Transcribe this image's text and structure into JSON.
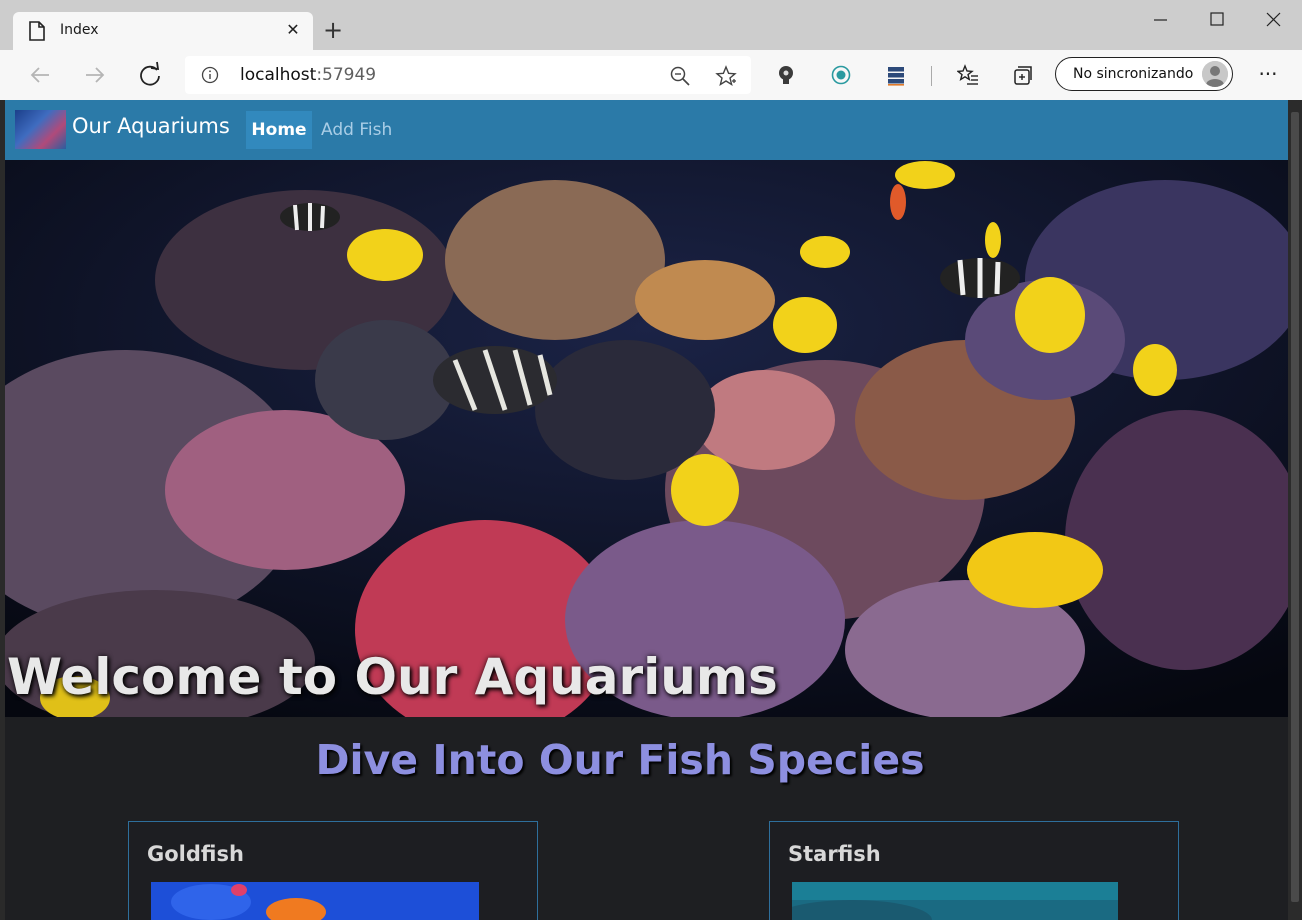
{
  "browser": {
    "tab_title": "Index",
    "tab_close": "✕",
    "new_tab": "+",
    "url_host": "localhost",
    "url_port": ":57949",
    "sync_label": "No sincronizando",
    "more": "···"
  },
  "site": {
    "brand": "Our Aquariums",
    "nav": {
      "home": "Home",
      "add_fish": "Add Fish"
    },
    "hero_title": "Welcome to Our Aquariums",
    "section_title": "Dive Into Our Fish Species",
    "cards": [
      {
        "title": "Goldfish"
      },
      {
        "title": "Starfish"
      }
    ]
  },
  "colors": {
    "navbar": "#2b7aa8",
    "nav_active": "#3289bd",
    "section_title": "#8d8fe0",
    "page_bg": "#1e1f22",
    "card_border": "#2e6f9c"
  }
}
